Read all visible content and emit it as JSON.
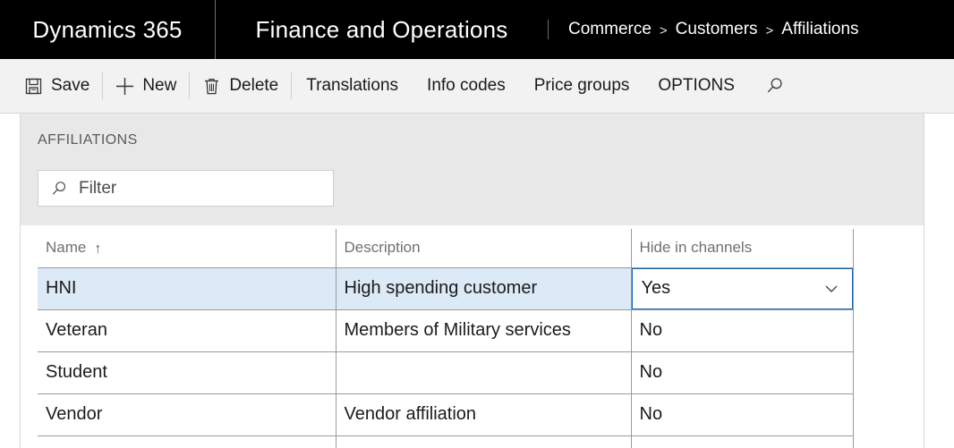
{
  "topbar": {
    "product": "Dynamics 365",
    "module": "Finance and Operations",
    "breadcrumb": [
      "Commerce",
      "Customers",
      "Affiliations"
    ],
    "separator": ">"
  },
  "toolbar": {
    "items": [
      {
        "label": "Save",
        "icon": "save-icon"
      },
      {
        "label": "New",
        "icon": "plus-icon"
      },
      {
        "label": "Delete",
        "icon": "trash-icon"
      },
      {
        "label": "Translations",
        "icon": ""
      },
      {
        "label": "Info codes",
        "icon": ""
      },
      {
        "label": "Price groups",
        "icon": ""
      },
      {
        "label": "OPTIONS",
        "icon": ""
      }
    ],
    "search_icon": "search-icon"
  },
  "page": {
    "section_title": "AFFILIATIONS",
    "filter": {
      "icon": "search-icon",
      "placeholder": "Filter",
      "value": ""
    }
  },
  "grid": {
    "columns": [
      {
        "label": "Name",
        "sort": "↑"
      },
      {
        "label": "Description",
        "sort": ""
      },
      {
        "label": "Hide in channels",
        "sort": ""
      }
    ],
    "rows": [
      {
        "name": "HNI",
        "description": "High spending customer",
        "hide_in_channels": "Yes",
        "selected": true,
        "active_cell": "hide_in_channels"
      },
      {
        "name": "Veteran",
        "description": "Members of Military services",
        "hide_in_channels": "No",
        "selected": false,
        "active_cell": ""
      },
      {
        "name": "Student",
        "description": "",
        "hide_in_channels": "No",
        "selected": false,
        "active_cell": ""
      },
      {
        "name": "Vendor",
        "description": "Vendor affiliation",
        "hide_in_channels": "No",
        "selected": false,
        "active_cell": ""
      }
    ]
  },
  "colors": {
    "topbar_bg": "#000000",
    "toolbar_bg": "#f2f2f2",
    "panel_bg": "#e8e8e8",
    "selected_row": "#dce9f7",
    "active_cell_border": "#1267b1",
    "grid_line": "#9a9a9a"
  }
}
